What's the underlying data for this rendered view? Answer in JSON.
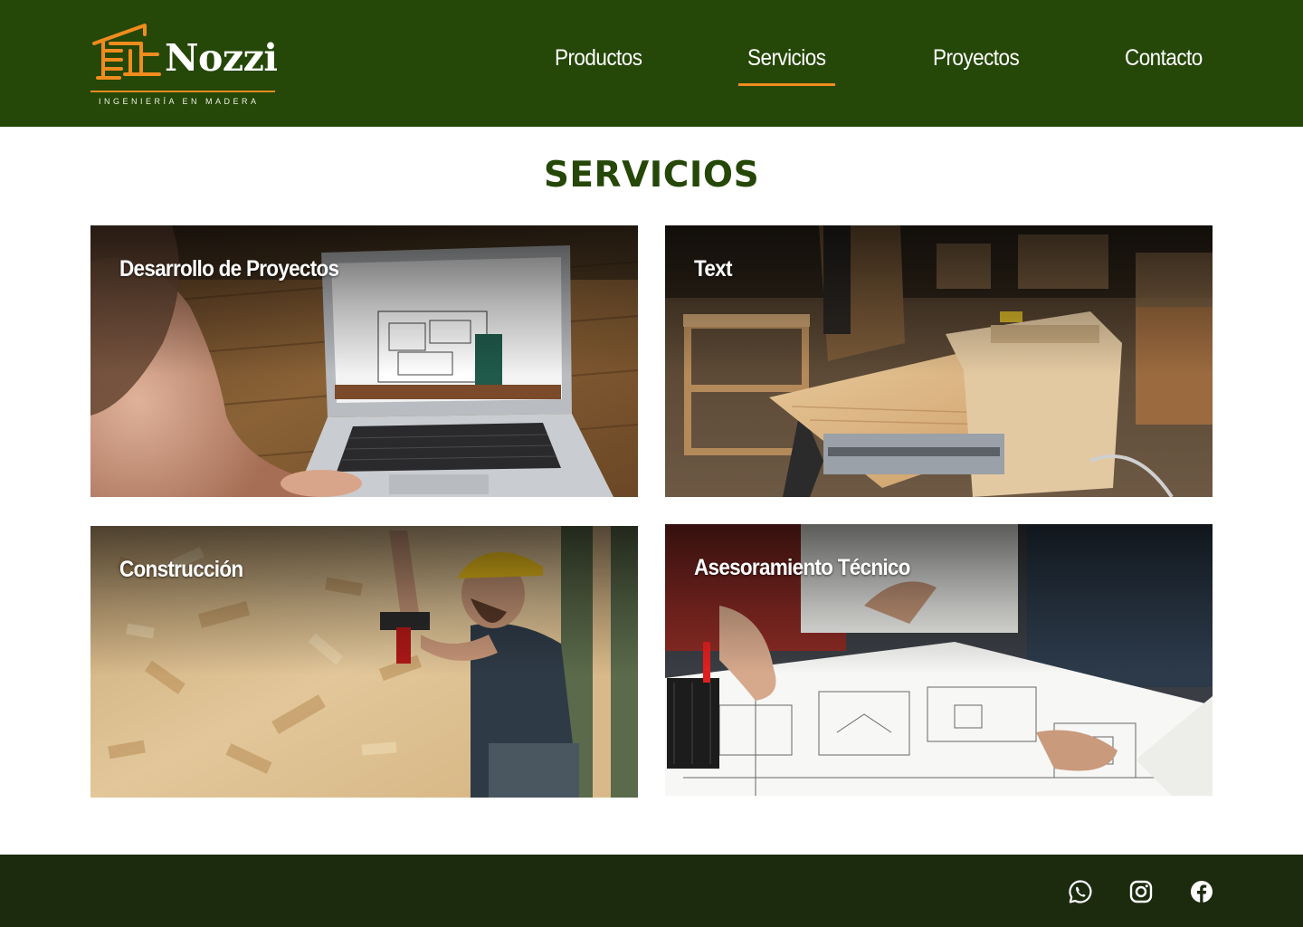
{
  "brand": {
    "name": "Nozzi",
    "tagline": "INGENIERÍA EN MADERA",
    "accent_color": "#f08c1e",
    "header_color": "#254708",
    "footer_color": "#1c2a0e"
  },
  "nav": {
    "items": [
      {
        "label": "Productos",
        "active": false
      },
      {
        "label": "Servicios",
        "active": true
      },
      {
        "label": "Proyectos",
        "active": false
      },
      {
        "label": "Contacto",
        "active": false
      }
    ]
  },
  "main": {
    "title": "SERVICIOS",
    "cards": [
      {
        "label": "Desarrollo de Proyectos",
        "image": "woman-laptop-floorplan-photo"
      },
      {
        "label": "Text",
        "image": "carpenter-workshop-table-saw-photo"
      },
      {
        "label": "Construcción",
        "image": "worker-drilling-osb-wall-photo"
      },
      {
        "label": "Asesoramiento Técnico",
        "image": "architects-blueprints-photo"
      }
    ]
  },
  "footer": {
    "social": [
      {
        "name": "whatsapp-icon"
      },
      {
        "name": "instagram-icon"
      },
      {
        "name": "facebook-icon"
      }
    ]
  }
}
